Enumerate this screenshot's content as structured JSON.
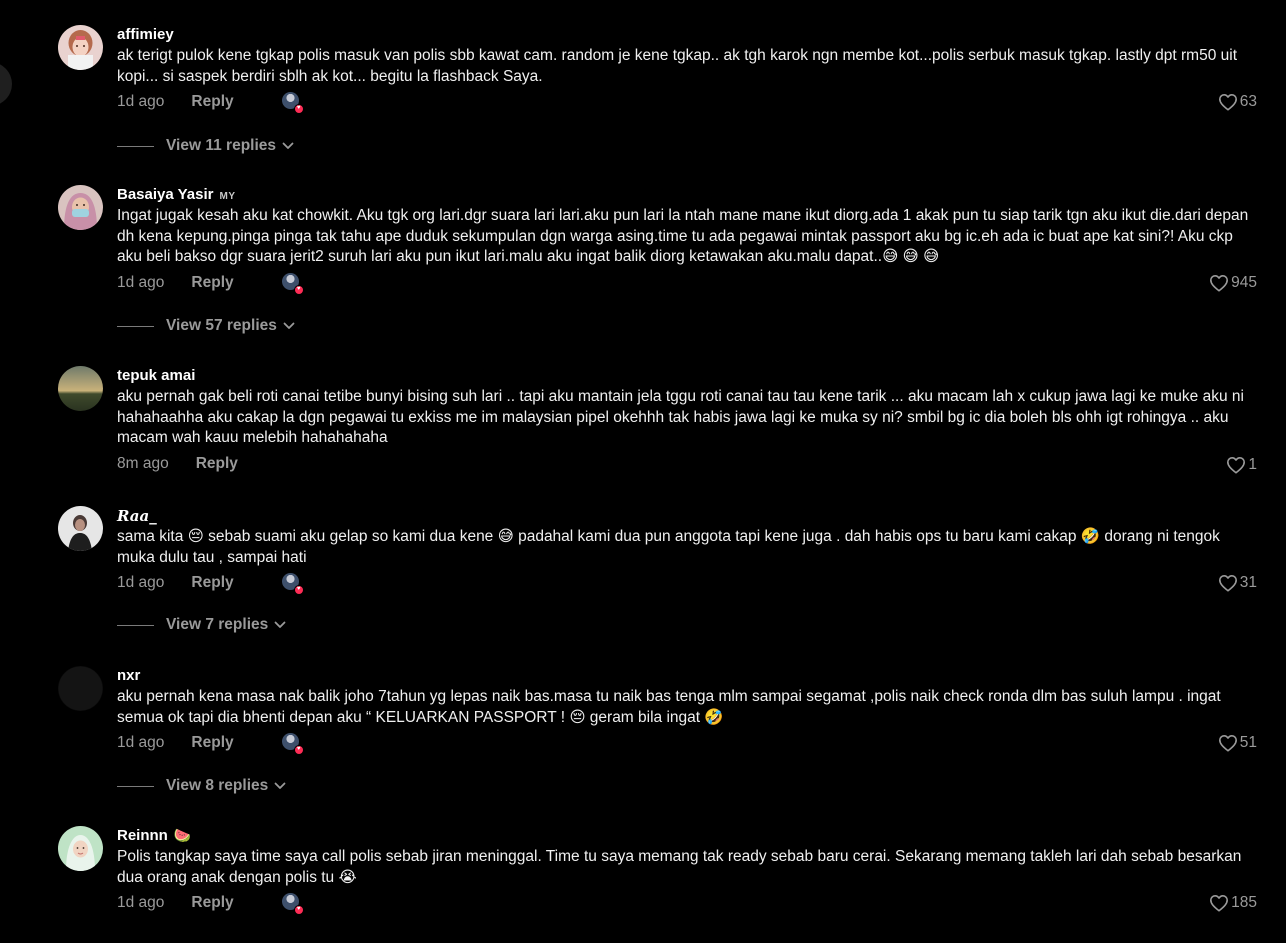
{
  "comments": [
    {
      "username": "affimiey",
      "region": "",
      "text": "ak terigt pulok kene tgkap polis masuk van polis sbb kawat cam. random je kene tgkap.. ak tgh karok ngn membe kot...polis serbuk masuk tgkap. lastly dpt rm50 uit kopi... si saspek berdiri sblh ak kot... begitu la flashback Saya.",
      "time": "1d ago",
      "reply_label": "Reply",
      "likes": "63",
      "view_replies": "View 11 replies"
    },
    {
      "username": "Basaiya Yasir",
      "region": "MY",
      "text": "Ingat jugak kesah aku kat chowkit. Aku tgk org lari.dgr suara lari lari.aku pun lari la ntah mane mane ikut diorg.ada 1 akak pun tu siap tarik tgn aku ikut die.dari depan dh kena kepung.pinga pinga tak tahu ape duduk sekumpulan dgn warga asing.time tu ada pegawai mintak passport aku bg ic.eh ada ic buat ape kat sini?! Aku ckp aku beli bakso dgr suara jerit2 suruh lari aku pun ikut lari.malu aku ingat balik diorg ketawakan aku.malu dapat..😅 😅 😅",
      "time": "1d ago",
      "reply_label": "Reply",
      "likes": "945",
      "view_replies": "View 57 replies"
    },
    {
      "username": "tepuk amai",
      "region": "",
      "text": "aku pernah gak beli roti canai tetibe bunyi bising suh lari .. tapi aku mantain jela tggu roti canai tau tau kene tarik ... aku macam lah x cukup jawa lagi ke muke aku ni hahahaahha aku cakap la dgn pegawai tu exkiss me im malaysian pipel okehhh tak habis jawa lagi ke muka sy ni? smbil bg ic dia boleh bls ohh igt rohingya .. aku macam wah kauu melebih hahahahaha",
      "time": "8m ago",
      "reply_label": "Reply",
      "likes": "1",
      "view_replies": ""
    },
    {
      "username": "Raa_",
      "region": "",
      "text": "sama kita 😔 sebab suami aku gelap so kami dua kene 😅 padahal kami dua pun anggota tapi kene juga . dah habis ops tu baru kami cakap 🤣 dorang ni tengok muka dulu tau , sampai hati",
      "time": "1d ago",
      "reply_label": "Reply",
      "likes": "31",
      "view_replies": "View 7 replies"
    },
    {
      "username": "nxr",
      "region": "",
      "text": "aku pernah kena masa nak balik joho 7tahun yg lepas naik bas.masa tu naik bas tenga mlm sampai segamat ,polis naik check ronda dlm bas suluh lampu . ingat semua ok tapi dia bhenti depan aku “ KELUARKAN PASSPORT ! 😔 geram bila ingat 🤣",
      "time": "1d ago",
      "reply_label": "Reply",
      "likes": "51",
      "view_replies": "View 8 replies"
    },
    {
      "username": "Reinnn",
      "region": "",
      "name_emoji": "🍉",
      "text": "Polis tangkap saya time saya call polis sebab jiran meninggal. Time tu saya memang tak ready sebab baru cerai. Sekarang memang takleh lari dah sebab besarkan dua orang anak dengan polis tu 😭",
      "time": "1d ago",
      "reply_label": "Reply",
      "likes": "185",
      "view_replies": ""
    }
  ],
  "icons": {
    "like": "heart-outline-icon",
    "chevron": "chevron-down-icon",
    "creator_liked": "creator-liked-avatar-icon"
  },
  "colors": {
    "background": "#000000",
    "text": "#f0f0f0",
    "muted": "#9a9a9a",
    "badge": "#fe2c55"
  }
}
